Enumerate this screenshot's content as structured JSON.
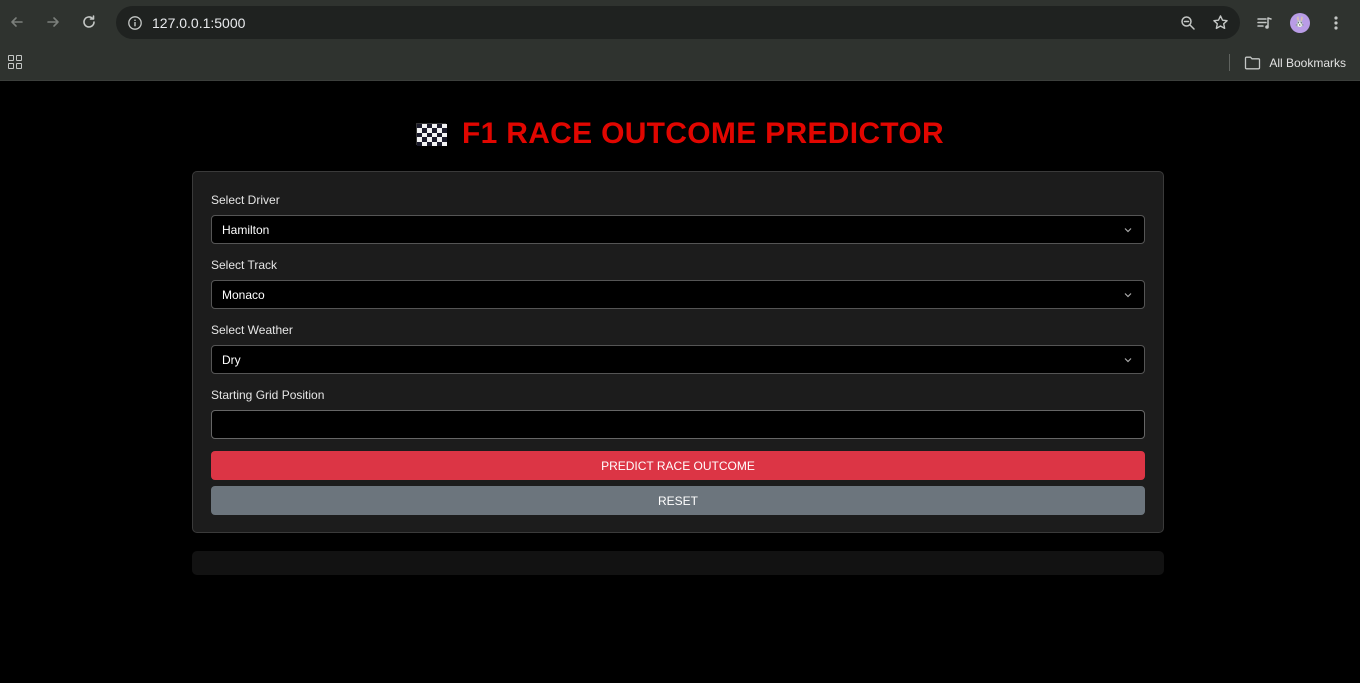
{
  "browser": {
    "url": "127.0.0.1:5000",
    "bookmarks_label": "All Bookmarks",
    "avatar_glyph": "🐰"
  },
  "page": {
    "title": "F1 RACE OUTCOME PREDICTOR",
    "title_color": "#e10600"
  },
  "form": {
    "driver": {
      "label": "Select Driver",
      "value": "Hamilton"
    },
    "track": {
      "label": "Select Track",
      "value": "Monaco"
    },
    "weather": {
      "label": "Select Weather",
      "value": "Dry"
    },
    "grid_position": {
      "label": "Starting Grid Position",
      "value": ""
    },
    "predict_label": "PREDICT RACE OUTCOME",
    "reset_label": "RESET",
    "predict_color": "#dc3545",
    "reset_color": "#6c757d"
  }
}
